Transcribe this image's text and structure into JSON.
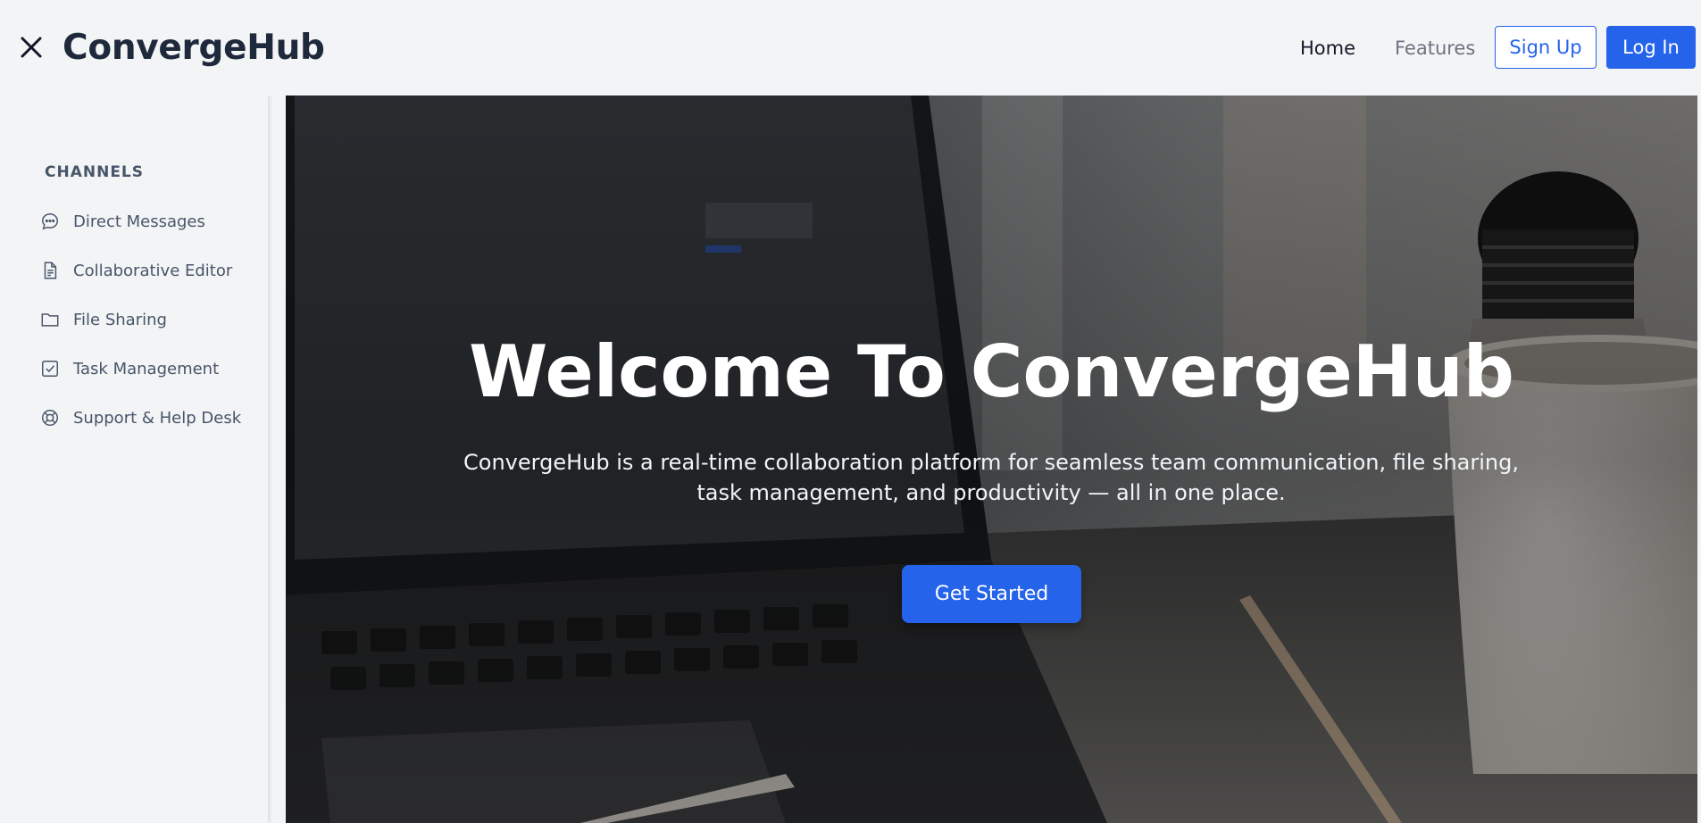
{
  "header": {
    "brand": "ConvergeHub",
    "close_icon": "close-icon",
    "nav": {
      "home": "Home",
      "features": "Features"
    },
    "signup_label": "Sign Up",
    "login_label": "Log In"
  },
  "sidebar": {
    "heading": "CHANNELS",
    "items": [
      {
        "label": "Direct Messages",
        "icon": "chat-bubble-icon"
      },
      {
        "label": "Collaborative Editor",
        "icon": "document-icon"
      },
      {
        "label": "File Sharing",
        "icon": "folder-icon"
      },
      {
        "label": "Task Management",
        "icon": "checkbox-icon"
      },
      {
        "label": "Support & Help Desk",
        "icon": "lifebuoy-icon"
      }
    ]
  },
  "hero": {
    "title": "Welcome To ConvergeHub",
    "description": "ConvergeHub is a real-time collaboration platform for seamless team communication, file sharing, task management, and productivity — all in one place.",
    "cta_label": "Get Started"
  },
  "colors": {
    "accent": "#2563eb",
    "brand_text": "#1e293b",
    "background": "#f3f4f6"
  }
}
